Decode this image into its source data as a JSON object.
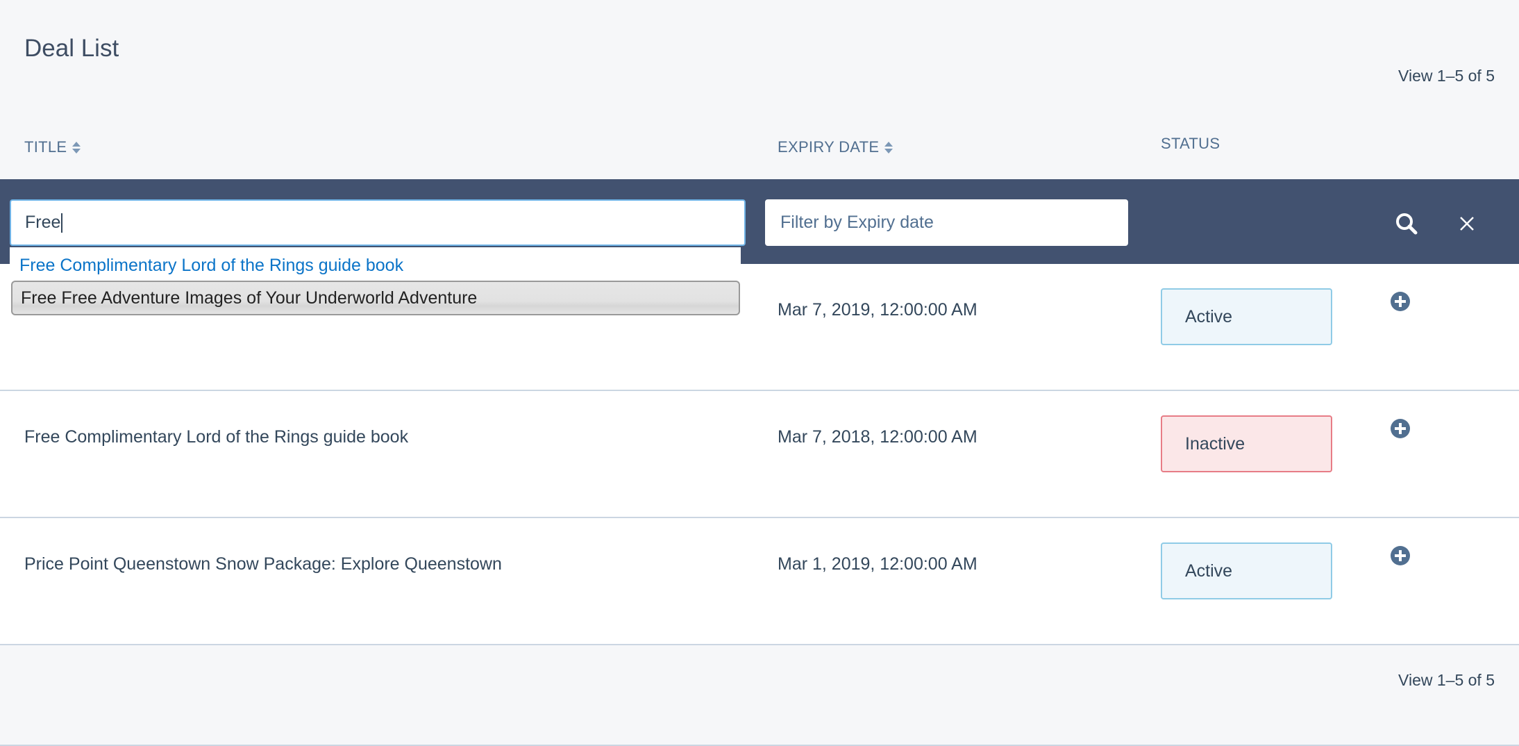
{
  "page_title": "Deal List",
  "pagination_top": "View 1–5 of 5",
  "pagination_bottom": "View 1–5 of 5",
  "columns": {
    "title": "TITLE",
    "expiry": "EXPIRY DATE",
    "status": "STATUS"
  },
  "filters": {
    "title_value": "Free",
    "expiry_placeholder": "Filter by Expiry date",
    "search_icon": "search-icon",
    "clear_icon": "close-icon"
  },
  "autocomplete": [
    "Free Complimentary Lord of the Rings guide book",
    "Free Free Adventure Images of Your Underworld Adventure"
  ],
  "rows": [
    {
      "title": "",
      "expiry": "Mar 7, 2019, 12:00:00 AM",
      "status": "Active"
    },
    {
      "title": "Free Complimentary Lord of the Rings guide book",
      "expiry": "Mar 7, 2018, 12:00:00 AM",
      "status": "Inactive"
    },
    {
      "title": "Price Point Queenstown Snow Package: Explore Queenstown",
      "expiry": "Mar 1, 2019, 12:00:00 AM",
      "status": "Active"
    }
  ],
  "colors": {
    "filter_bar": "#425270",
    "link": "#0b74c8",
    "active_border": "#8fcbe6",
    "inactive_border": "#e77c86"
  }
}
